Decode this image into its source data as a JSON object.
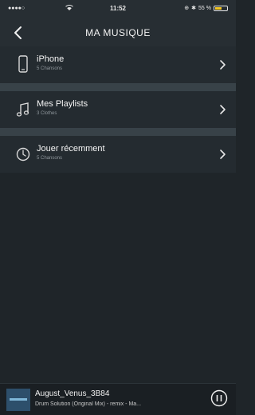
{
  "status": {
    "signal": "●●●●○",
    "time": "11:52",
    "battery_text": "55 %",
    "battery_level": 0.55,
    "accent_battery": "#f3c623"
  },
  "nav": {
    "title": "MA MUSIQUE",
    "back_icon": "chevron-left-icon"
  },
  "rows": [
    {
      "label": "iPhone",
      "sub": "5 Chansons",
      "icon": "phone-icon"
    },
    {
      "label": "Mes Playlists",
      "sub": "3 Clothes",
      "icon": "music-note-icon"
    },
    {
      "label": "Jouer récemment",
      "sub": "5 Chansons",
      "icon": "clock-icon"
    }
  ],
  "player": {
    "song": "August_Venus_3B84",
    "artist": "Drum Solution (Original Mix) - remix - Ma..."
  }
}
